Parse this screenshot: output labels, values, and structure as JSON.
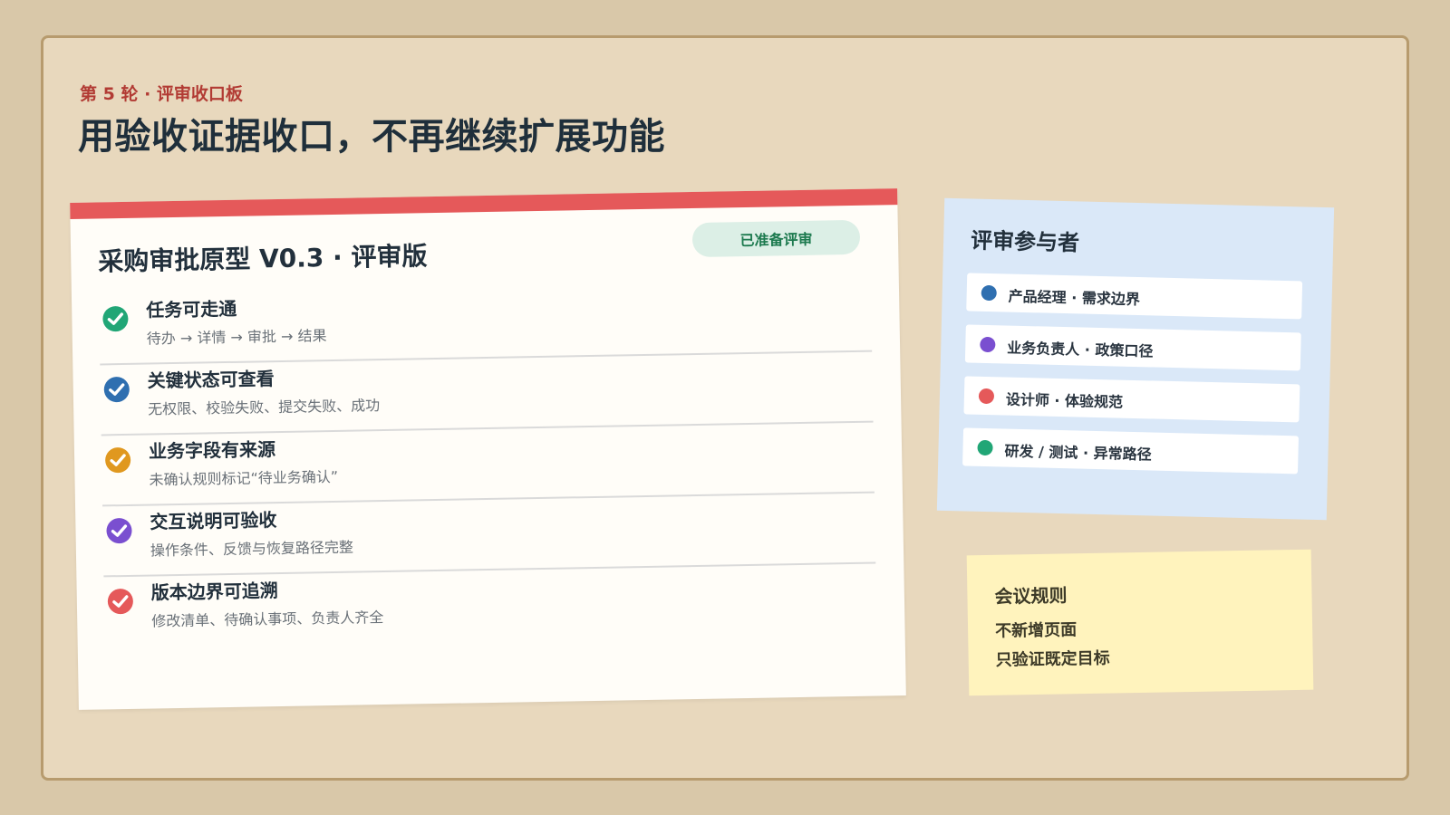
{
  "header": {
    "eyebrow": "第 5 轮 · 评审收口板",
    "headline": "用验收证据收口，不再继续扩展功能"
  },
  "main_card": {
    "accent_color": "#e5595a",
    "title": "采购审批原型 V0.3 · 评审版",
    "status": "已准备评审",
    "checklist": [
      {
        "title": "任务可走通",
        "desc": "待办 → 详情 → 审批 → 结果",
        "icon": "check-circle-icon",
        "color": "#21a676"
      },
      {
        "title": "关键状态可查看",
        "desc": "无权限、校验失败、提交失败、成功",
        "icon": "check-circle-icon",
        "color": "#2f6fb0"
      },
      {
        "title": "业务字段有来源",
        "desc": "未确认规则标记“待业务确认”",
        "icon": "check-circle-icon",
        "color": "#e0981f"
      },
      {
        "title": "交互说明可验收",
        "desc": "操作条件、反馈与恢复路径完整",
        "icon": "check-circle-icon",
        "color": "#7a4fd0"
      },
      {
        "title": "版本边界可追溯",
        "desc": "修改清单、待确认事项、负责人齐全",
        "icon": "check-circle-icon",
        "color": "#e5595a"
      }
    ]
  },
  "participants": {
    "title": "评审参与者",
    "items": [
      {
        "label": "产品经理 · 需求边界",
        "color": "#2f6fb0"
      },
      {
        "label": "业务负责人 · 政策口径",
        "color": "#7a4fd0"
      },
      {
        "label": "设计师 · 体验规范",
        "color": "#e5595a"
      },
      {
        "label": "研发 / 测试 · 异常路径",
        "color": "#21a676"
      }
    ]
  },
  "rules": {
    "title": "会议规则",
    "lines": [
      "不新增页面",
      "只验证既定目标"
    ]
  }
}
